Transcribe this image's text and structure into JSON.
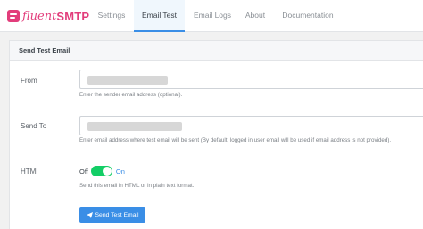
{
  "app": {
    "logo_prefix": "fluent",
    "logo_suffix": "SMTP",
    "brand_color": "#e23d7b",
    "accent_color": "#3a8ee6"
  },
  "nav": {
    "tabs": [
      {
        "label": "Settings",
        "active": false
      },
      {
        "label": "Email Test",
        "active": true
      },
      {
        "label": "Email Logs",
        "active": false
      },
      {
        "label": "About",
        "active": false
      },
      {
        "label": "Documentation",
        "active": false
      }
    ]
  },
  "panel": {
    "title": "Send Test Email",
    "from": {
      "label": "From",
      "value": "",
      "help": "Enter the sender email address (optional)."
    },
    "send_to": {
      "label": "Send To",
      "value": "",
      "help": "Enter email address where test email will be sent (By default, logged in user email will be used if email address is not provided)."
    },
    "html": {
      "label": "HTMl",
      "off_label": "Off",
      "on_label": "On",
      "enabled": true,
      "help": "Send this email in HTML or in plain text format."
    },
    "send_button": {
      "label": "Send Test Email",
      "icon": "paper-plane-icon"
    }
  }
}
